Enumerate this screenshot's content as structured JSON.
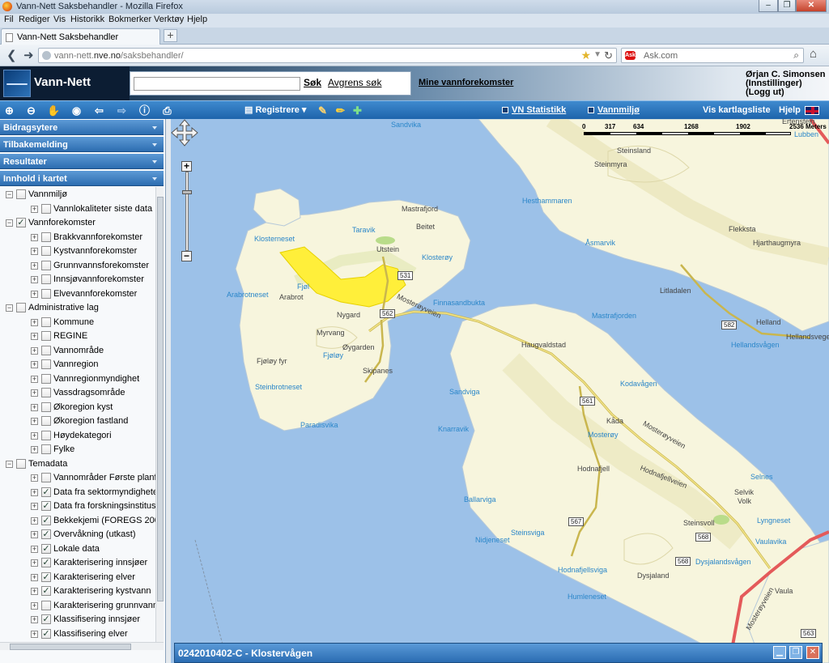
{
  "window": {
    "title": "Vann-Nett Saksbehandler - Mozilla Firefox"
  },
  "menu": [
    "Fil",
    "Rediger",
    "Vis",
    "Historikk",
    "Bokmerker",
    "Verktøy",
    "Hjelp"
  ],
  "tab": {
    "title": "Vann-Nett Saksbehandler",
    "new_tab": "+"
  },
  "nav": {
    "url_host": "vann-nett.",
    "url_domain": "nve.no",
    "url_path": "/saksbehandler/",
    "search_placeholder": "Ask.com",
    "search_engine": "Ask"
  },
  "header": {
    "brand": "Vann-Nett",
    "search_value": "",
    "search_button": "Søk",
    "clear_search": "Avgrens søk",
    "mine_link": "Mine vannforekomster",
    "user_name": "Ørjan C. Simonsen",
    "user_settings": "(Innstillinger)",
    "user_logout": "(Logg ut)"
  },
  "toolbar": {
    "registrere": "Registrere",
    "vn_statistikk": "VN Statistikk",
    "vannmiljo": "Vannmiljø",
    "layers": "Vis kartlagsliste",
    "help": "Hjelp"
  },
  "sidebar": {
    "panels": [
      "Bidragsytere",
      "Tilbakemelding",
      "Resultater",
      "Innhold i kartet"
    ],
    "tree": [
      {
        "label": "Vannmiljø",
        "level": 0,
        "checked": false
      },
      {
        "label": "Vannlokaliteter siste data",
        "level": 1,
        "checked": false
      },
      {
        "label": "Vannforekomster",
        "level": 0,
        "checked": true
      },
      {
        "label": "Brakkvannforekomster",
        "level": 1,
        "checked": false
      },
      {
        "label": "Kystvannforekomster",
        "level": 1,
        "checked": false
      },
      {
        "label": "Grunnvannsforekomster",
        "level": 1,
        "checked": false
      },
      {
        "label": "Innsjøvannforekomster",
        "level": 1,
        "checked": false
      },
      {
        "label": "Elvevannforekomster",
        "level": 1,
        "checked": false
      },
      {
        "label": "Administrative lag",
        "level": 0,
        "checked": false
      },
      {
        "label": "Kommune",
        "level": 1,
        "checked": false
      },
      {
        "label": "REGINE",
        "level": 1,
        "checked": false
      },
      {
        "label": "Vannområde",
        "level": 1,
        "checked": false
      },
      {
        "label": "Vannregion",
        "level": 1,
        "checked": false
      },
      {
        "label": "Vannregionmyndighet",
        "level": 1,
        "checked": false
      },
      {
        "label": "Vassdragsområde",
        "level": 1,
        "checked": false
      },
      {
        "label": "Økoregion kyst",
        "level": 1,
        "checked": false
      },
      {
        "label": "Økoregion fastland",
        "level": 1,
        "checked": false
      },
      {
        "label": "Høydekategori",
        "level": 1,
        "checked": false
      },
      {
        "label": "Fylke",
        "level": 1,
        "checked": false
      },
      {
        "label": "Temadata",
        "level": 0,
        "checked": false
      },
      {
        "label": "Vannområder Første planfa",
        "level": 1,
        "checked": false
      },
      {
        "label": "Data fra sektormyndighete",
        "level": 1,
        "checked": true
      },
      {
        "label": "Data fra forskningsinstitusj",
        "level": 1,
        "checked": true
      },
      {
        "label": "Bekkekjemi (FOREGS 2008",
        "level": 1,
        "checked": true
      },
      {
        "label": "Overvåkning (utkast)",
        "level": 1,
        "checked": true
      },
      {
        "label": "Lokale data",
        "level": 1,
        "checked": true
      },
      {
        "label": "Karakterisering innsjøer",
        "level": 1,
        "checked": true
      },
      {
        "label": "Karakterisering elver",
        "level": 1,
        "checked": true
      },
      {
        "label": "Karakterisering kystvann",
        "level": 1,
        "checked": true
      },
      {
        "label": "Karakterisering grunnvann",
        "level": 1,
        "checked": false
      },
      {
        "label": "Klassifisering innsjøer",
        "level": 1,
        "checked": true
      },
      {
        "label": "Klassifisering elver",
        "level": 1,
        "checked": true
      }
    ]
  },
  "map": {
    "scale_labels": [
      "0",
      "317",
      "634",
      "1268",
      "1902",
      "2536 Meters"
    ],
    "zoom_in": "+",
    "zoom_out": "−",
    "labels": {
      "sandvika_n": "Sandvika",
      "ertenstein": "Ertenstein",
      "lubben": "Lubben",
      "steinsland": "Steinsland",
      "steinmyra": "Steinmyra",
      "hesthammaren": "Hesthammaren",
      "asmarvik": "Åsmarvik",
      "flekksta": "Flekksta",
      "hjarthaugmyra": "Hjarthaugmyra",
      "litladalen": "Litladalen",
      "helland": "Helland",
      "hellandsvegen": "Hellandsvegen",
      "hellandsvagen": "Hellandsvågen",
      "mastrafjord": "Mastrafjord",
      "beitet": "Beitet",
      "taravik": "Taravik",
      "klosterneset": "Klosterneset",
      "utstein": "Utstein",
      "klosteroy": "Klosterøy",
      "fjoly_n": "Fjøl",
      "arabrotneset": "Arabrotneset",
      "arabrot": "Arabrot",
      "nygard": "Nygard",
      "finnasandbukta": "Finnasandbukta",
      "mosteroyveien_n": "Mosterøyveien",
      "mastrafjorden": "Mastrafjorden",
      "myrvang": "Myrvang",
      "oygarden": "Øygarden",
      "fjoloy": "Fjøløy",
      "fjoloy_fyr": "Fjøløy fyr",
      "skipanes": "Skipanes",
      "haugvaldstad": "Haugvaldstad",
      "steinbrotneset": "Steinbrotneset",
      "kodavagen": "Kodavågen",
      "sandviga": "Sandviga",
      "paradisvika": "Paradisvika",
      "knarravik": "Knarravik",
      "kada": "Kåda",
      "mosteroy": "Mosterøy",
      "mosteroyveien_s": "Mosterøyveien",
      "hodnafjell": "Hodnafjell",
      "hodnafjellveien": "Hodnafjellveien",
      "selvik": "Selvik",
      "volk": "Volk",
      "selnes": "Selnes",
      "ballarviga": "Ballarviga",
      "lyngneset": "Lyngneset",
      "steinsvoll": "Steinsvoll",
      "vaulavika": "Vaulavika",
      "steinsviga": "Steinsviga",
      "nidjeneset": "Nidjeneset",
      "dysjalandsvagen": "Dysjalandsvågen",
      "hodnafjellsviga": "Hodnafjellsviga",
      "dysjaland": "Dysjaland",
      "vaula": "Vaula",
      "humleneset": "Humleneset",
      "mosteroyveien_se": "Mosterøyveien"
    },
    "roads": [
      "531",
      "562",
      "561",
      "582",
      "567",
      "568",
      "568",
      "563"
    ],
    "selection_color": "#ffef3a"
  },
  "info_panel": {
    "title": "0242010402-C - Klostervågen"
  },
  "colors": {
    "toolbar": "#2b74bf",
    "water": "#9cc1e8",
    "land": "#f7f5dd",
    "label_blue": "#2a86c9"
  }
}
